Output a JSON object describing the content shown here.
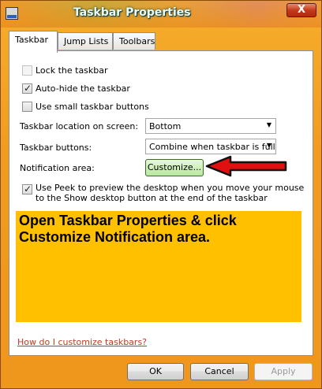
{
  "window": {
    "title": "Taskbar Properties",
    "close_label": "X"
  },
  "tabs": [
    {
      "label": "Taskbar",
      "active": true
    },
    {
      "label": "Jump Lists",
      "active": false
    },
    {
      "label": "Toolbars",
      "active": false
    }
  ],
  "options": {
    "lock": {
      "label": "Lock the taskbar",
      "checked": false
    },
    "autohide": {
      "label": "Auto-hide the taskbar",
      "checked": true
    },
    "small": {
      "label": "Use small taskbar buttons",
      "checked": false
    }
  },
  "location": {
    "label": "Taskbar location on screen:",
    "value": "Bottom"
  },
  "buttons": {
    "label": "Taskbar buttons:",
    "value": "Combine when taskbar is full"
  },
  "notification": {
    "label": "Notification area:",
    "customize_label": "Customize..."
  },
  "peek": {
    "label": "Use Peek to preview the desktop when you move your mouse to the Show desktop button at the end of the taskbar",
    "checked": true
  },
  "annotation": {
    "text": "Open Taskbar Properties & click Customize Notification area."
  },
  "help_link": "How do I customize taskbars?",
  "footer": {
    "ok": "OK",
    "cancel": "Cancel",
    "apply": "Apply"
  },
  "colors": {
    "annotation_bg": "#ffc000",
    "window_frame": "#f19b20",
    "arrow": "#e01010",
    "link": "#c0392b"
  }
}
